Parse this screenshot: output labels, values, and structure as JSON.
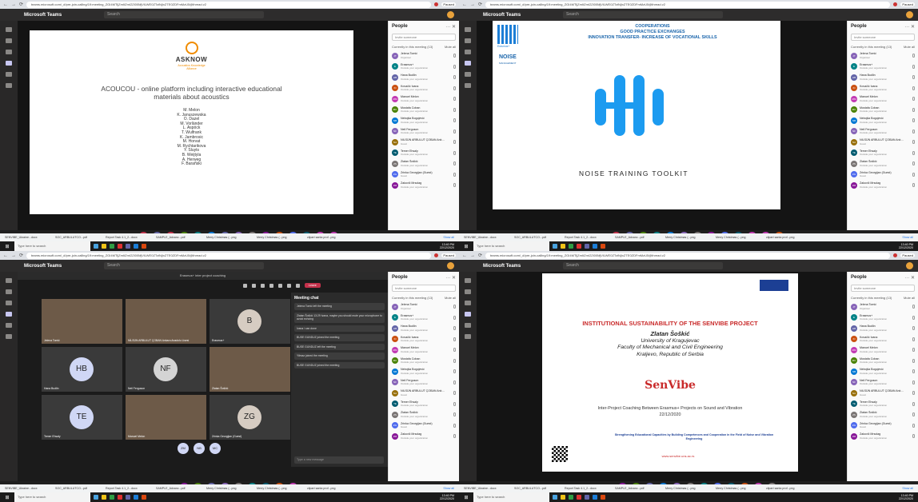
{
  "browser": {
    "url": "teams.microsoft.com/_#/pre-join-calling/19:meeting_ZGI4MTljZmItZmI2Zi00MjVlLWE0ZTctNjIxZTE0ZDFmMzU5@thread.v2",
    "profile": "Paused"
  },
  "app": {
    "title": "Microsoft Teams",
    "search_placeholder": "Search"
  },
  "rail_icons": [
    "activity-icon",
    "chat-icon",
    "teams-icon",
    "calendar-icon",
    "calls-icon",
    "files-icon"
  ],
  "q0": {
    "logo_top": "ASKNOW",
    "logo_sub": "Acoustics Knowledge Alliance",
    "title": "ACOUCOU - online platform including interactive educational materials about acoustics",
    "authors": [
      "M. Melon",
      "K. Januszewska",
      "O. Dazel",
      "M. Vorländer",
      "L. Aspöck",
      "T. Wulfrank",
      "K. Jambrosic",
      "M. Horvat",
      "M. Rychtarikova",
      "Y. Sluyts",
      "B. Weijtyla",
      "A. Herweg",
      "F. Barañski"
    ]
  },
  "q1": {
    "line1": "COOPERATIONS",
    "line2": "GOOD PRACTICE EXCHANGES",
    "line3": "INNOVATION TRANSFER- INCREASE OF VOCATIONAL SKILLS",
    "logo_label": "Erasmus+",
    "brand": "NOISE",
    "brand_sub": "MANAGEMENT",
    "caption": "NOISE TRAINING TOOLKIT"
  },
  "q2": {
    "meeting_title": "Erasmus+ inter project coaching",
    "leave_label": "Leave",
    "tiles": [
      {
        "name": "Jelena Tomić",
        "initials": ""
      },
      {
        "name": "NİLSÜN ARBULUT ÇOBAN Ankara Anadolu Lisesi",
        "initials": ""
      },
      {
        "name": "Erasmus+",
        "initials": "B"
      },
      {
        "name": "Hana Budlin",
        "initials": "HB"
      },
      {
        "name": "Neil Ferguson",
        "initials": "NF"
      },
      {
        "name": "Zlatan Šoškić",
        "initials": ""
      },
      {
        "name": "Temer Ehsaly",
        "initials": "TE"
      },
      {
        "name": "Manuel Melon",
        "initials": ""
      },
      {
        "name": "Zrinka Georgijan (Guest)",
        "initials": "ZG"
      }
    ],
    "bottom_avatars": [
      "ZM",
      "NB",
      "MC"
    ],
    "chat_title": "Meeting chat",
    "chat_msgs": [
      "Jelena Tomić left the meeting",
      "Zlatan Šoškić 13:29  Ivana, maybe you should mute your microphone to avoid echoing",
      "Ivana  i can done",
      "BUSE GUNDUZ joined the meeting",
      "BUSE GUNDUZ left the meeting",
      "Yilmaz joined the meeting",
      "BUSE GUNDUZ joined the meeting"
    ],
    "chat_input": "Type a new message"
  },
  "q3": {
    "title": "INSTITUTIONAL SUSTAINABILITY OF THE SENVIBE PROJECT",
    "speaker": "Zlatan Šoškić",
    "univ": "University of Kragujevac",
    "faculty": "Faculty of Mechanical and Civil Engineering",
    "city": "Kraljevo, Republic of Serbia",
    "brand": "SenVibe",
    "coaching": "Inter-Project Coaching Between Erasmus+ Projects on Sound and Vibration",
    "date": "22/12/2020",
    "footer": "Strengthening Educational Capacities by Building Competences and Cooperation in the Field of Noise and Vibration Engineering",
    "url": "www.senvibe.uns.ac.rs"
  },
  "people": {
    "title": "People",
    "invite_placeholder": "Invite someone",
    "section": "Currently in this meeting (13)",
    "mute_all": "Mute all",
    "list": [
      {
        "initials": "JT",
        "name": "Jelena Tomić",
        "sub": "Organiser",
        "color": "#8764b8"
      },
      {
        "initials": "E",
        "name": "Erasmus+",
        "sub": "Outside your organization",
        "color": "#038387"
      },
      {
        "initials": "HB",
        "name": "Hana Budlin",
        "sub": "Outside your organization",
        "color": "#6264a7"
      },
      {
        "initials": "KI",
        "name": "Kovačić Ivana",
        "sub": "Outside your organization",
        "color": "#ca5010"
      },
      {
        "initials": "MM",
        "name": "Manuel Melon",
        "sub": "Outside your organization",
        "color": "#c239b3"
      },
      {
        "initials": "MC",
        "name": "Mustafa Coban",
        "sub": "Outside your organization",
        "color": "#498205"
      },
      {
        "initials": "NB",
        "name": "Nebojša Bogojević",
        "sub": "Outside your organization",
        "color": "#0078d4"
      },
      {
        "initials": "NF",
        "name": "Neil Ferguson",
        "sub": "Outside your organization",
        "color": "#8764b8"
      },
      {
        "initials": "NA",
        "name": "NİLSÜN ARBULUT ÇOBAN Ank…",
        "sub": "Guest",
        "color": "#986f0b"
      },
      {
        "initials": "TE",
        "name": "Temer Ehsaly",
        "sub": "Outside your organization",
        "color": "#005b70"
      },
      {
        "initials": "ZS",
        "name": "Zlatan Šoškić",
        "sub": "Outside your organization",
        "color": "#7a7574"
      },
      {
        "initials": "ZG",
        "name": "Zrinka Georgijan (Guest)",
        "sub": "Guest",
        "color": "#4f6bed"
      },
      {
        "initials": "ZM",
        "name": "Zakovič Mrsolag",
        "sub": "Outside your organization",
        "color": "#881798"
      }
    ]
  },
  "avatars_q0": [
    {
      "i": "CR",
      "c": "#c4314b"
    },
    {
      "i": "NG",
      "c": "#6264a7"
    },
    {
      "i": "CR",
      "c": "#c4314b"
    },
    {
      "i": "MC",
      "c": "#498205"
    },
    {
      "i": "DA",
      "c": "#038387"
    },
    {
      "i": "NB",
      "c": "#0078d4"
    },
    {
      "i": "HB",
      "c": "#6264a7"
    },
    {
      "i": "NF",
      "c": "#8764b8"
    },
    {
      "i": "",
      "c": "#7a7574"
    },
    {
      "i": "ZM",
      "c": "#881798"
    },
    {
      "i": "ND",
      "c": "#ca5010"
    },
    {
      "i": "B",
      "c": "#4f6bed"
    },
    {
      "i": "TE",
      "c": "#005b70"
    },
    {
      "i": "KI",
      "c": "#c239b3"
    },
    {
      "i": "MM",
      "c": "#c239b3"
    }
  ],
  "avatars_q1": [
    {
      "i": "CR",
      "c": "#c4314b"
    },
    {
      "i": "NG",
      "c": "#6264a7"
    },
    {
      "i": "MC",
      "c": "#498205"
    },
    {
      "i": "DA",
      "c": "#038387"
    },
    {
      "i": "NB",
      "c": "#0078d4"
    },
    {
      "i": "NF",
      "c": "#8764b8"
    },
    {
      "i": "",
      "c": "#7a7574"
    },
    {
      "i": "ZM",
      "c": "#881798"
    },
    {
      "i": "B",
      "c": "#4f6bed"
    },
    {
      "i": "TE",
      "c": "#005b70"
    },
    {
      "i": "MM",
      "c": "#c239b3"
    },
    {
      "i": "KI",
      "c": "#c239b3"
    },
    {
      "i": "ND",
      "c": "#ca5010"
    }
  ],
  "avatars_q2": [
    {
      "i": "ZM",
      "c": "#881798"
    },
    {
      "i": "MC",
      "c": "#498205"
    },
    {
      "i": "HB",
      "c": "#6264a7"
    },
    {
      "i": "NF",
      "c": "#8764b8"
    },
    {
      "i": "",
      "c": "#7a7574"
    },
    {
      "i": "DA",
      "c": "#038387"
    },
    {
      "i": "TE",
      "c": "#005b70"
    },
    {
      "i": "ND",
      "c": "#ca5010"
    },
    {
      "i": "KI",
      "c": "#c239b3"
    }
  ],
  "avatars_q3": [
    {
      "i": "ZM",
      "c": "#881798"
    },
    {
      "i": "MC",
      "c": "#498205"
    },
    {
      "i": "HB",
      "c": "#6264a7"
    },
    {
      "i": "NB",
      "c": "#0078d4"
    },
    {
      "i": "NF",
      "c": "#8764b8"
    },
    {
      "i": "",
      "c": "#7a7574"
    },
    {
      "i": "DA",
      "c": "#038387"
    },
    {
      "i": "B",
      "c": "#4f6bed"
    },
    {
      "i": "TE",
      "c": "#005b70"
    },
    {
      "i": "ND",
      "c": "#ca5010"
    },
    {
      "i": "KI",
      "c": "#c239b3"
    },
    {
      "i": "",
      "c": "#7a7574"
    }
  ],
  "downloads": [
    "SENVIBE_Ukraine...docx",
    "SOC_ARBULUTCO...pdf",
    "Report Task 4.1_2...docx",
    "SAMPLE_Advanc...pdf",
    "Merry Christmas (...png",
    "Merry Christmas (...png",
    "clipart santa prof...png"
  ],
  "show_all": "Show all",
  "taskbar": {
    "search": "Type here to search",
    "time": "13:40 PM",
    "date": "22/12/2020"
  }
}
